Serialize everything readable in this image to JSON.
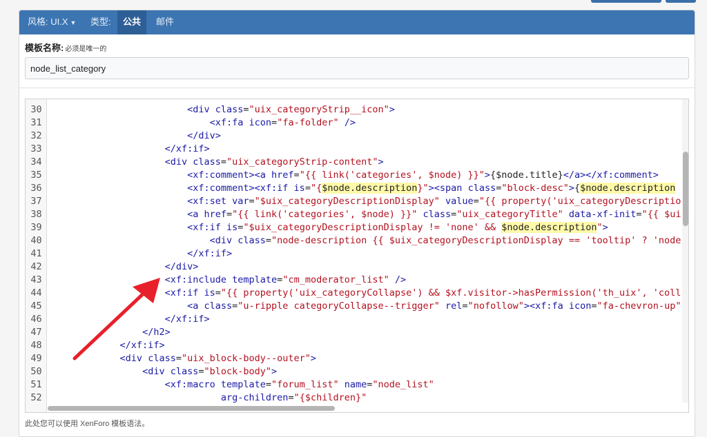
{
  "nav": {
    "style_label": "风格: UI.X",
    "type_label": "类型:",
    "tab_public": "公共",
    "tab_email": "邮件"
  },
  "form": {
    "name_label": "模板名称:",
    "name_hint": "必须是唯一的",
    "name_value": "node_list_category",
    "footer_hint": "此处您可以使用 XenForo 模板语法。"
  },
  "editor": {
    "lines": [
      {
        "num": "30",
        "indent": 6,
        "tokens": [
          [
            "tag",
            "<div "
          ],
          [
            "attr",
            "class"
          ],
          [
            "p",
            "="
          ],
          [
            "str",
            "\"uix_categoryStrip__icon\""
          ],
          [
            "tag",
            ">"
          ]
        ]
      },
      {
        "num": "31",
        "indent": 7,
        "tokens": [
          [
            "tag",
            "<xf:fa "
          ],
          [
            "attr",
            "icon"
          ],
          [
            "p",
            "="
          ],
          [
            "str",
            "\"fa-folder\""
          ],
          [
            "tag",
            " />"
          ]
        ]
      },
      {
        "num": "32",
        "indent": 6,
        "tokens": [
          [
            "tag",
            "</div>"
          ]
        ]
      },
      {
        "num": "33",
        "indent": 5,
        "tokens": [
          [
            "tag",
            "</xf:if>"
          ]
        ]
      },
      {
        "num": "34",
        "indent": 5,
        "tokens": [
          [
            "tag",
            "<div "
          ],
          [
            "attr",
            "class"
          ],
          [
            "p",
            "="
          ],
          [
            "str",
            "\"uix_categoryStrip-content\""
          ],
          [
            "tag",
            ">"
          ]
        ]
      },
      {
        "num": "35",
        "indent": 6,
        "tokens": [
          [
            "tag",
            "<xf:comment><a "
          ],
          [
            "attr",
            "href"
          ],
          [
            "p",
            "="
          ],
          [
            "str",
            "\"{{ link('categories', $node) }}\""
          ],
          [
            "tag",
            ">"
          ],
          [
            "p",
            "{$node.title}"
          ],
          [
            "tag",
            "</a></xf:comment>"
          ]
        ]
      },
      {
        "num": "36",
        "indent": 6,
        "tokens": [
          [
            "tag",
            "<xf:comment><xf:if "
          ],
          [
            "attr",
            "is"
          ],
          [
            "p",
            "="
          ],
          [
            "str",
            "\"{"
          ],
          [
            "hl",
            "$node.description"
          ],
          [
            "str",
            "}\""
          ],
          [
            "tag",
            "><span "
          ],
          [
            "attr",
            "class"
          ],
          [
            "p",
            "="
          ],
          [
            "str",
            "\"block-desc\""
          ],
          [
            "tag",
            ">"
          ],
          [
            "p",
            "{"
          ],
          [
            "hl",
            "$node.description"
          ]
        ]
      },
      {
        "num": "37",
        "indent": 6,
        "tokens": [
          [
            "tag",
            "<xf:set "
          ],
          [
            "attr",
            "var"
          ],
          [
            "p",
            "="
          ],
          [
            "str",
            "\"$uix_categoryDescriptionDisplay\""
          ],
          [
            "p",
            " "
          ],
          [
            "attr",
            "value"
          ],
          [
            "p",
            "="
          ],
          [
            "str",
            "\"{{ property('uix_categoryDescriptio"
          ]
        ]
      },
      {
        "num": "38",
        "indent": 6,
        "tokens": [
          [
            "tag",
            "<a "
          ],
          [
            "attr",
            "href"
          ],
          [
            "p",
            "="
          ],
          [
            "str",
            "\"{{ link('categories', $node) }}\""
          ],
          [
            "p",
            " "
          ],
          [
            "attr",
            "class"
          ],
          [
            "p",
            "="
          ],
          [
            "str",
            "\"uix_categoryTitle\""
          ],
          [
            "p",
            " "
          ],
          [
            "attr",
            "data-xf-init"
          ],
          [
            "p",
            "="
          ],
          [
            "str",
            "\"{{ $ui"
          ]
        ]
      },
      {
        "num": "39",
        "indent": 6,
        "tokens": [
          [
            "tag",
            "<xf:if "
          ],
          [
            "attr",
            "is"
          ],
          [
            "p",
            "="
          ],
          [
            "str",
            "\"$uix_categoryDescriptionDisplay != 'none' && "
          ],
          [
            "hl",
            "$node.description"
          ],
          [
            "str",
            "\""
          ],
          [
            "tag",
            ">"
          ]
        ]
      },
      {
        "num": "40",
        "indent": 7,
        "tokens": [
          [
            "tag",
            "<div "
          ],
          [
            "attr",
            "class"
          ],
          [
            "p",
            "="
          ],
          [
            "str",
            "\"node-description {{ $uix_categoryDescriptionDisplay == 'tooltip' ? 'node"
          ]
        ]
      },
      {
        "num": "41",
        "indent": 6,
        "tokens": [
          [
            "tag",
            "</xf:if>"
          ]
        ]
      },
      {
        "num": "42",
        "indent": 5,
        "tokens": [
          [
            "tag",
            "</div>"
          ]
        ]
      },
      {
        "num": "43",
        "indent": 5,
        "tokens": [
          [
            "tag",
            "<xf:include "
          ],
          [
            "attr",
            "template"
          ],
          [
            "p",
            "="
          ],
          [
            "str",
            "\"cm_moderator_list\""
          ],
          [
            "tag",
            " />"
          ]
        ]
      },
      {
        "num": "44",
        "indent": 5,
        "tokens": [
          [
            "tag",
            "<xf:if "
          ],
          [
            "attr",
            "is"
          ],
          [
            "p",
            "="
          ],
          [
            "str",
            "\"{{ property('uix_categoryCollapse') && $xf.visitor->hasPermission('th_uix', 'coll"
          ]
        ]
      },
      {
        "num": "45",
        "indent": 6,
        "tokens": [
          [
            "tag",
            "<a "
          ],
          [
            "attr",
            "class"
          ],
          [
            "p",
            "="
          ],
          [
            "str",
            "\"u-ripple categoryCollapse--trigger\""
          ],
          [
            "p",
            " "
          ],
          [
            "attr",
            "rel"
          ],
          [
            "p",
            "="
          ],
          [
            "str",
            "\"nofollow\""
          ],
          [
            "tag",
            "><xf:fa "
          ],
          [
            "attr",
            "icon"
          ],
          [
            "p",
            "="
          ],
          [
            "str",
            "\"fa-chevron-up\""
          ]
        ]
      },
      {
        "num": "46",
        "indent": 5,
        "tokens": [
          [
            "tag",
            "</xf:if>"
          ]
        ]
      },
      {
        "num": "47",
        "indent": 4,
        "tokens": [
          [
            "tag",
            "</h2>"
          ]
        ]
      },
      {
        "num": "48",
        "indent": 3,
        "tokens": [
          [
            "tag",
            "</xf:if>"
          ]
        ]
      },
      {
        "num": "49",
        "indent": 3,
        "tokens": [
          [
            "tag",
            "<div "
          ],
          [
            "attr",
            "class"
          ],
          [
            "p",
            "="
          ],
          [
            "str",
            "\"uix_block-body--outer\""
          ],
          [
            "tag",
            ">"
          ]
        ]
      },
      {
        "num": "50",
        "indent": 4,
        "tokens": [
          [
            "tag",
            "<div "
          ],
          [
            "attr",
            "class"
          ],
          [
            "p",
            "="
          ],
          [
            "str",
            "\"block-body\""
          ],
          [
            "tag",
            ">"
          ]
        ]
      },
      {
        "num": "51",
        "indent": 5,
        "tokens": [
          [
            "tag",
            "<xf:macro "
          ],
          [
            "attr",
            "template"
          ],
          [
            "p",
            "="
          ],
          [
            "str",
            "\"forum_list\""
          ],
          [
            "p",
            " "
          ],
          [
            "attr",
            "name"
          ],
          [
            "p",
            "="
          ],
          [
            "str",
            "\"node_list\""
          ]
        ]
      },
      {
        "num": "52",
        "indent": 7.5,
        "tokens": [
          [
            "attr",
            "arg-children"
          ],
          [
            "p",
            "="
          ],
          [
            "str",
            "\"{$children}\""
          ]
        ]
      }
    ]
  },
  "colors": {
    "navbar": "#3c75b2",
    "tag": "#1a1aa6",
    "attr": "#1a1aa6",
    "string": "#b3111f",
    "highlight": "#fff9a8",
    "arrow": "#e8202a"
  }
}
